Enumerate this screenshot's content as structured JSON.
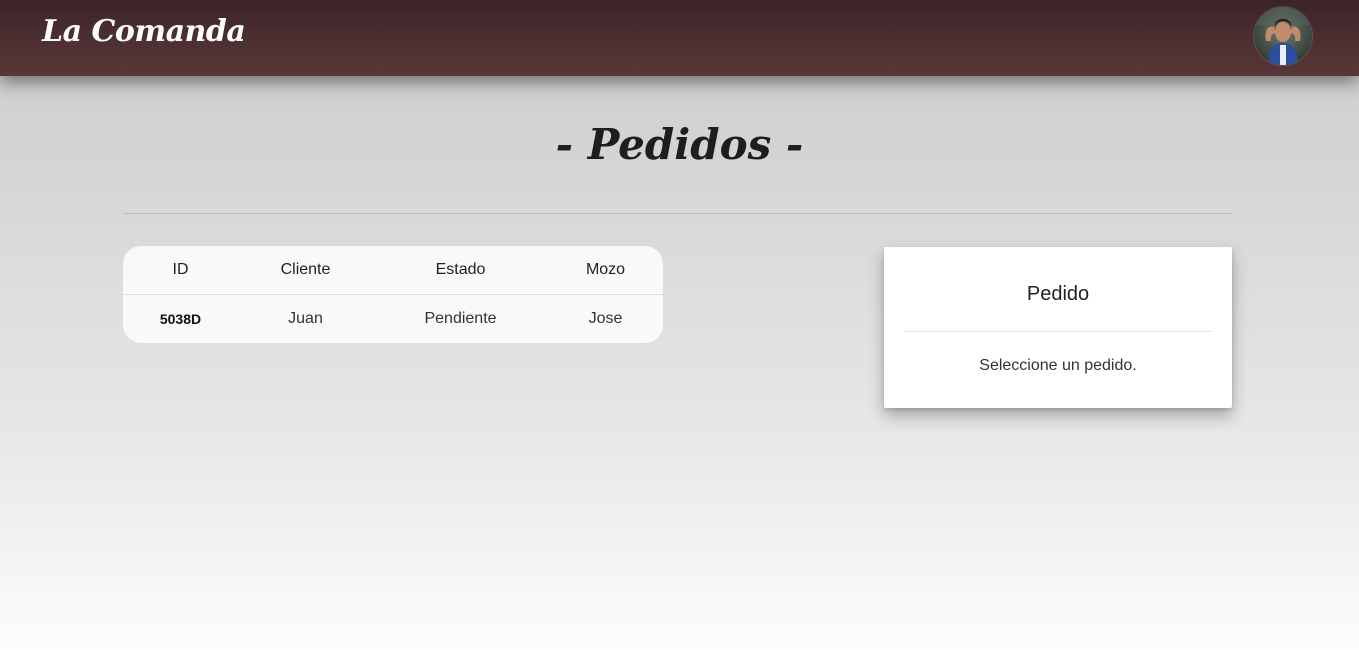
{
  "navbar": {
    "brand": "La Comanda",
    "avatar_icon": "user-avatar-icon"
  },
  "page": {
    "title": "- Pedidos -"
  },
  "orders_table": {
    "headers": [
      "ID",
      "Cliente",
      "Estado",
      "Mozo"
    ],
    "rows": [
      {
        "id": "5038D",
        "cliente": "Juan",
        "estado": "Pendiente",
        "mozo": "Jose"
      }
    ]
  },
  "detail_card": {
    "title": "Pedido",
    "message": "Seleccione un pedido."
  },
  "colors": {
    "navbar_top": "#3a2426",
    "navbar_bottom": "#573737",
    "background_top": "#c9c9c9",
    "background_bottom": "#fdfdfd",
    "card_background": "#ffffff"
  }
}
